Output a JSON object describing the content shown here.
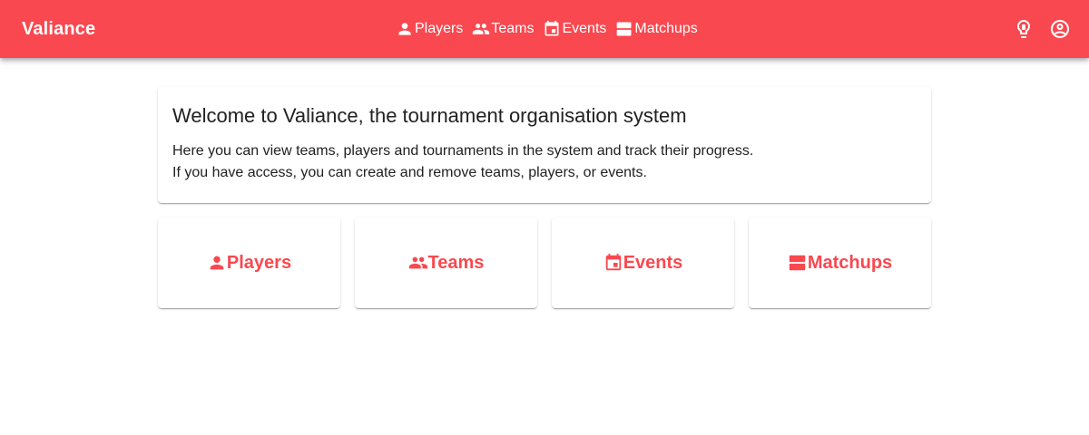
{
  "app": {
    "title": "Valiance"
  },
  "nav": [
    {
      "label": "Players",
      "icon": "person-icon"
    },
    {
      "label": "Teams",
      "icon": "people-icon"
    },
    {
      "label": "Events",
      "icon": "calendar-event-icon"
    },
    {
      "label": "Matchups",
      "icon": "view-agenda-icon"
    }
  ],
  "top_actions": [
    {
      "icon": "lightbulb-icon"
    },
    {
      "icon": "account-circle-icon"
    }
  ],
  "welcome": {
    "title": "Welcome to Valiance, the tournament organisation system",
    "line1": "Here you can view teams, players and tournaments in the system and track their progress.",
    "line2": "If you have access, you can create and remove teams, players, or events."
  },
  "tiles": [
    {
      "label": "Players",
      "icon": "person-icon"
    },
    {
      "label": "Teams",
      "icon": "people-icon"
    },
    {
      "label": "Events",
      "icon": "calendar-event-icon"
    },
    {
      "label": "Matchups",
      "icon": "view-agenda-icon"
    }
  ],
  "colors": {
    "brand": "#f9484f",
    "on_brand": "#ffffff",
    "text": "#212121"
  }
}
